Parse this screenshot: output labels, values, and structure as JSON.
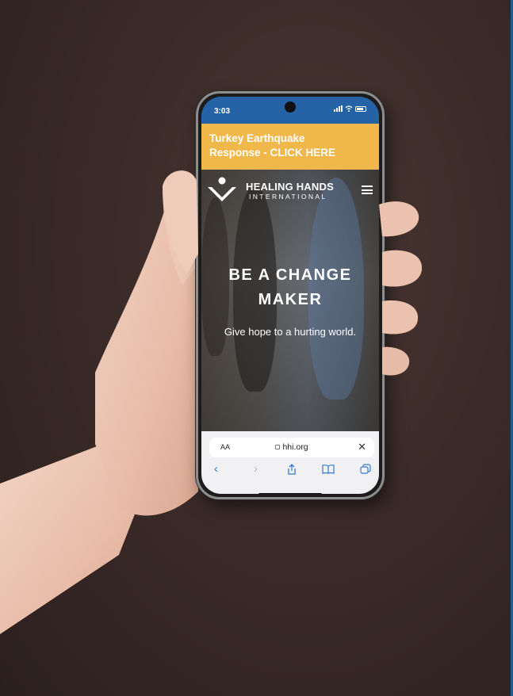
{
  "status_bar": {
    "time": "3:03"
  },
  "banner": {
    "line1": "Turkey Earthquake",
    "line2": "Response - CLICK HERE"
  },
  "logo": {
    "name": "HEALING HANDS",
    "tagline": "INTERNATIONAL"
  },
  "hero": {
    "title_line1": "BE A CHANGE",
    "title_line2": "MAKER",
    "subtitle": "Give hope to a hurting world."
  },
  "browser": {
    "text_size": "AA",
    "url": "hhi.org",
    "close": "✕"
  },
  "colors": {
    "status_bar": "#2563a6",
    "banner": "#f0b84a",
    "browser_bar": "#f1f1f3",
    "link_blue": "#2f7ad6",
    "background": "#3b2b28"
  },
  "icons": [
    "menu-icon",
    "back-icon",
    "forward-icon",
    "share-icon",
    "bookmarks-icon",
    "tabs-icon",
    "lock-icon",
    "close-icon"
  ]
}
